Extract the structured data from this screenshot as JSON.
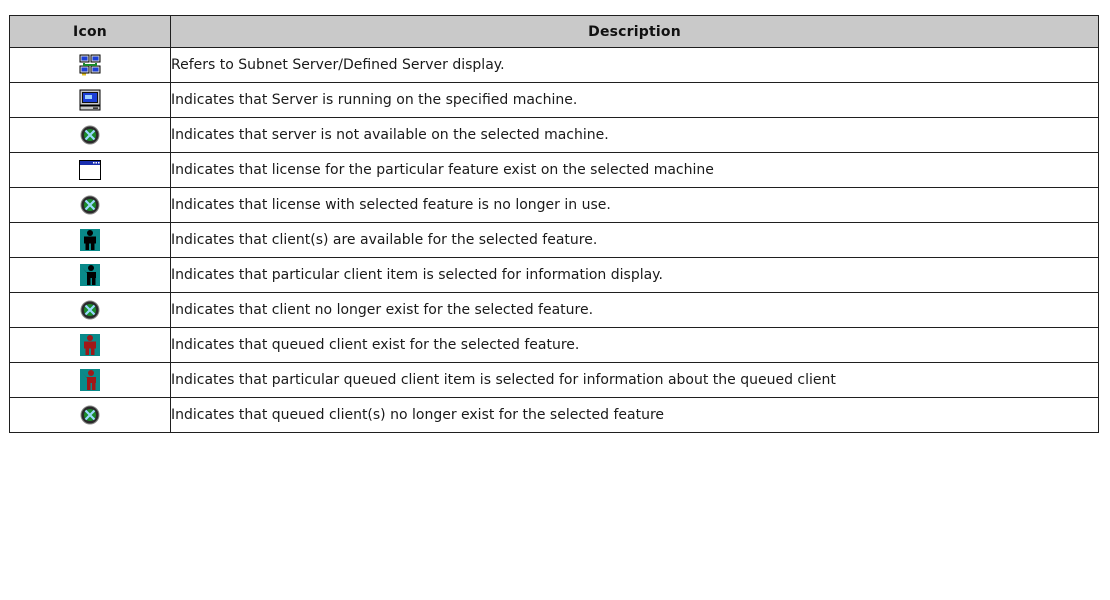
{
  "headers": {
    "icon": "Icon",
    "description": "Description"
  },
  "rows": [
    {
      "icon": "subnet-server-icon",
      "description": "Refers to Subnet Server/Defined Server display."
    },
    {
      "icon": "server-running-icon",
      "description": "Indicates that Server is running on the specified machine."
    },
    {
      "icon": "unavailable-globe-icon",
      "description": "Indicates that server is not available on the selected machine."
    },
    {
      "icon": "license-window-icon",
      "description": "Indicates that license for the particular feature exist on the selected machine"
    },
    {
      "icon": "unavailable-globe-icon",
      "description": "Indicates that license with selected feature is no longer in use."
    },
    {
      "icon": "client-icon",
      "description": "Indicates that client(s) are available for the selected feature."
    },
    {
      "icon": "client-selected-icon",
      "description": "Indicates that particular client item is selected for information display."
    },
    {
      "icon": "unavailable-globe-icon",
      "description": "Indicates that client no longer exist for the selected feature."
    },
    {
      "icon": "queued-client-icon",
      "description": "Indicates that queued client exist for the selected feature."
    },
    {
      "icon": "queued-client-selected-icon",
      "description": "Indicates that particular queued client item is selected for information about the queued client"
    },
    {
      "icon": "unavailable-globe-icon",
      "description": "Indicates that queued client(s) no longer exist for the selected feature"
    }
  ],
  "colors": {
    "header_bg": "#c9c9c9",
    "border": "#1f1f1f",
    "client_bg": "#0a8a8a",
    "queued_figure": "#a01818"
  }
}
